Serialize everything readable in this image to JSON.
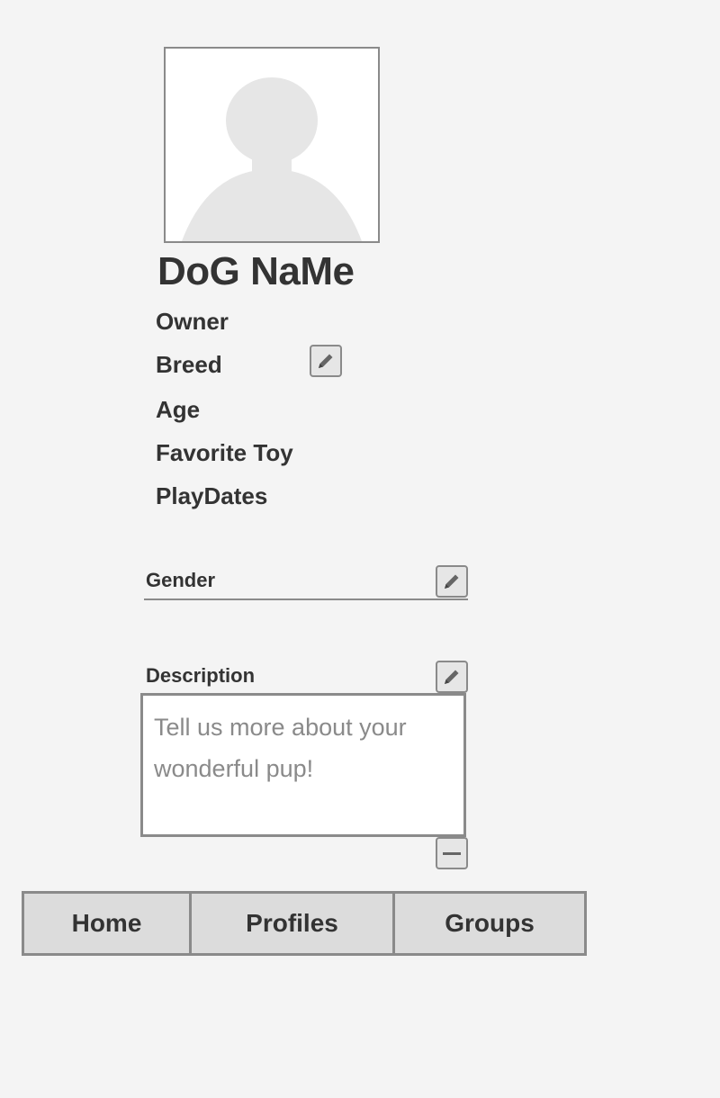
{
  "profile": {
    "dog_name": "DoG NaMe",
    "avatar_icon": "user-silhouette-icon"
  },
  "fields": [
    {
      "label": "Owner"
    },
    {
      "label": "Breed"
    },
    {
      "label": "Age"
    },
    {
      "label": "Favorite Toy"
    },
    {
      "label": "PlayDates"
    }
  ],
  "gender": {
    "label": "Gender",
    "value": ""
  },
  "description": {
    "label": "Description",
    "value": "",
    "placeholder": "Tell us more about your wonderful pup!"
  },
  "icons": {
    "edit": "pencil-icon",
    "collapse": "minus-icon"
  },
  "nav": {
    "tabs": [
      {
        "label": "Home"
      },
      {
        "label": "Profiles"
      },
      {
        "label": "Groups"
      }
    ]
  },
  "colors": {
    "background": "#f4f4f4",
    "border": "#8a8a8a",
    "text": "#333333",
    "nav_background": "#dcdcdc",
    "placeholder": "#8a8a8a"
  }
}
